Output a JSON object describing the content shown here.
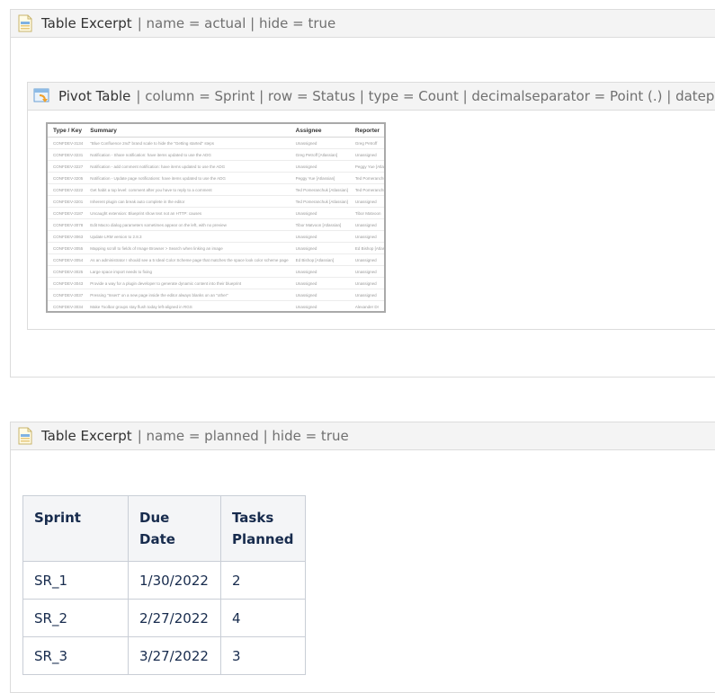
{
  "excerpt_actual": {
    "title": "Table Excerpt",
    "params": "| name = actual | hide = true",
    "pivot": {
      "title": "Pivot Table",
      "params": "| column = Sprint | row = Status | type = Count | decimalseparator = Point (.) | datep",
      "thumbnail": {
        "headers": [
          "Type / Key",
          "Summary",
          "Assignee",
          "Reporter"
        ],
        "rows": [
          [
            "CONFDEV-3134",
            "\"Blue Confluence 2nd\" brand scale to hide the \"Getting started\" steps",
            "Unassigned",
            "Greg Petroff"
          ],
          [
            "CONFDEV-3231",
            "Notification - Share notification: have items updated to use the ADG",
            "Greg Petroff [Atlassian]",
            "Unassigned"
          ],
          [
            "CONFDEV-3227",
            "Notification - add comment notification: have items updated to use the ADG",
            "Unassigned",
            "Peggy Yue [Atlassian]"
          ],
          [
            "CONFDEV-3205",
            "Notification - Update page notifications: have items updated to use the ADG",
            "Peggy Yue [Atlassian]",
            "Ted Pomeranchuk"
          ],
          [
            "CONFDEV-3222",
            "Get habit a top level: comment after you have to reply to a comment",
            "Ted Pomeranchuk [Atlassian]",
            "Ted Pomeranchuk"
          ],
          [
            "CONFDEV-3201",
            "Inherent plugin can break auto complete in the editor",
            "Ted Pomeranchuk [Atlassian]",
            "Unassigned"
          ],
          [
            "CONFDEV-3187",
            "Uncaught extension: Blueprint show text not an HTTP: causes",
            "Unassigned",
            "Tibor Matvoon"
          ],
          [
            "CONFDEV-3078",
            "Edit Macro dialog parameters sometimes appear on the left, with no preview",
            "Tibor Matvoon [Atlassian]",
            "Unassigned"
          ],
          [
            "CONFDEV-3063",
            "Update LRM version to 2.8.3",
            "Unassigned",
            "Unassigned"
          ],
          [
            "CONFDEV-3055",
            "Mapping scroll to fields of Image Browser > Search when linking an image",
            "Unassigned",
            "Ed Bishop [Atlassian]"
          ],
          [
            "CONFDEV-3054",
            "As an administrator I should see a 5 Ideal Color Scheme page that matches the space look color scheme page",
            "Ed Bishop [Atlassian]",
            "Unassigned"
          ],
          [
            "CONFDEV-3025",
            "Large space import needs to fixing",
            "Unassigned",
            "Unassigned"
          ],
          [
            "CONFDEV-3043",
            "Provide a way for a plugin developer to generate dynamic content into their blueprint",
            "Unassigned",
            "Unassigned"
          ],
          [
            "CONFDEV-3037",
            "Pressing \"Insert\" on a new page inside the editor always blanks on an \"other\"",
            "Unassigned",
            "Unassigned"
          ],
          [
            "CONFDEV-3034",
            "Make Toolbar groups stay flush today left-aligned in RGS",
            "Unassigned",
            "Alexander Dr"
          ],
          [
            "CONFDEV-3031",
            "Space directory does not load more items on scroll",
            "Unassigned",
            "Unassigned"
          ]
        ]
      }
    }
  },
  "excerpt_planned": {
    "title": "Table Excerpt",
    "params": "| name = planned | hide = true",
    "table": {
      "headers": [
        "Sprint",
        "Due Date",
        "Tasks Planned"
      ],
      "rows": [
        [
          "SR_1",
          "1/30/2022",
          "2"
        ],
        [
          "SR_2",
          "2/27/2022",
          "4"
        ],
        [
          "SR_3",
          "3/27/2022",
          "3"
        ]
      ]
    }
  }
}
